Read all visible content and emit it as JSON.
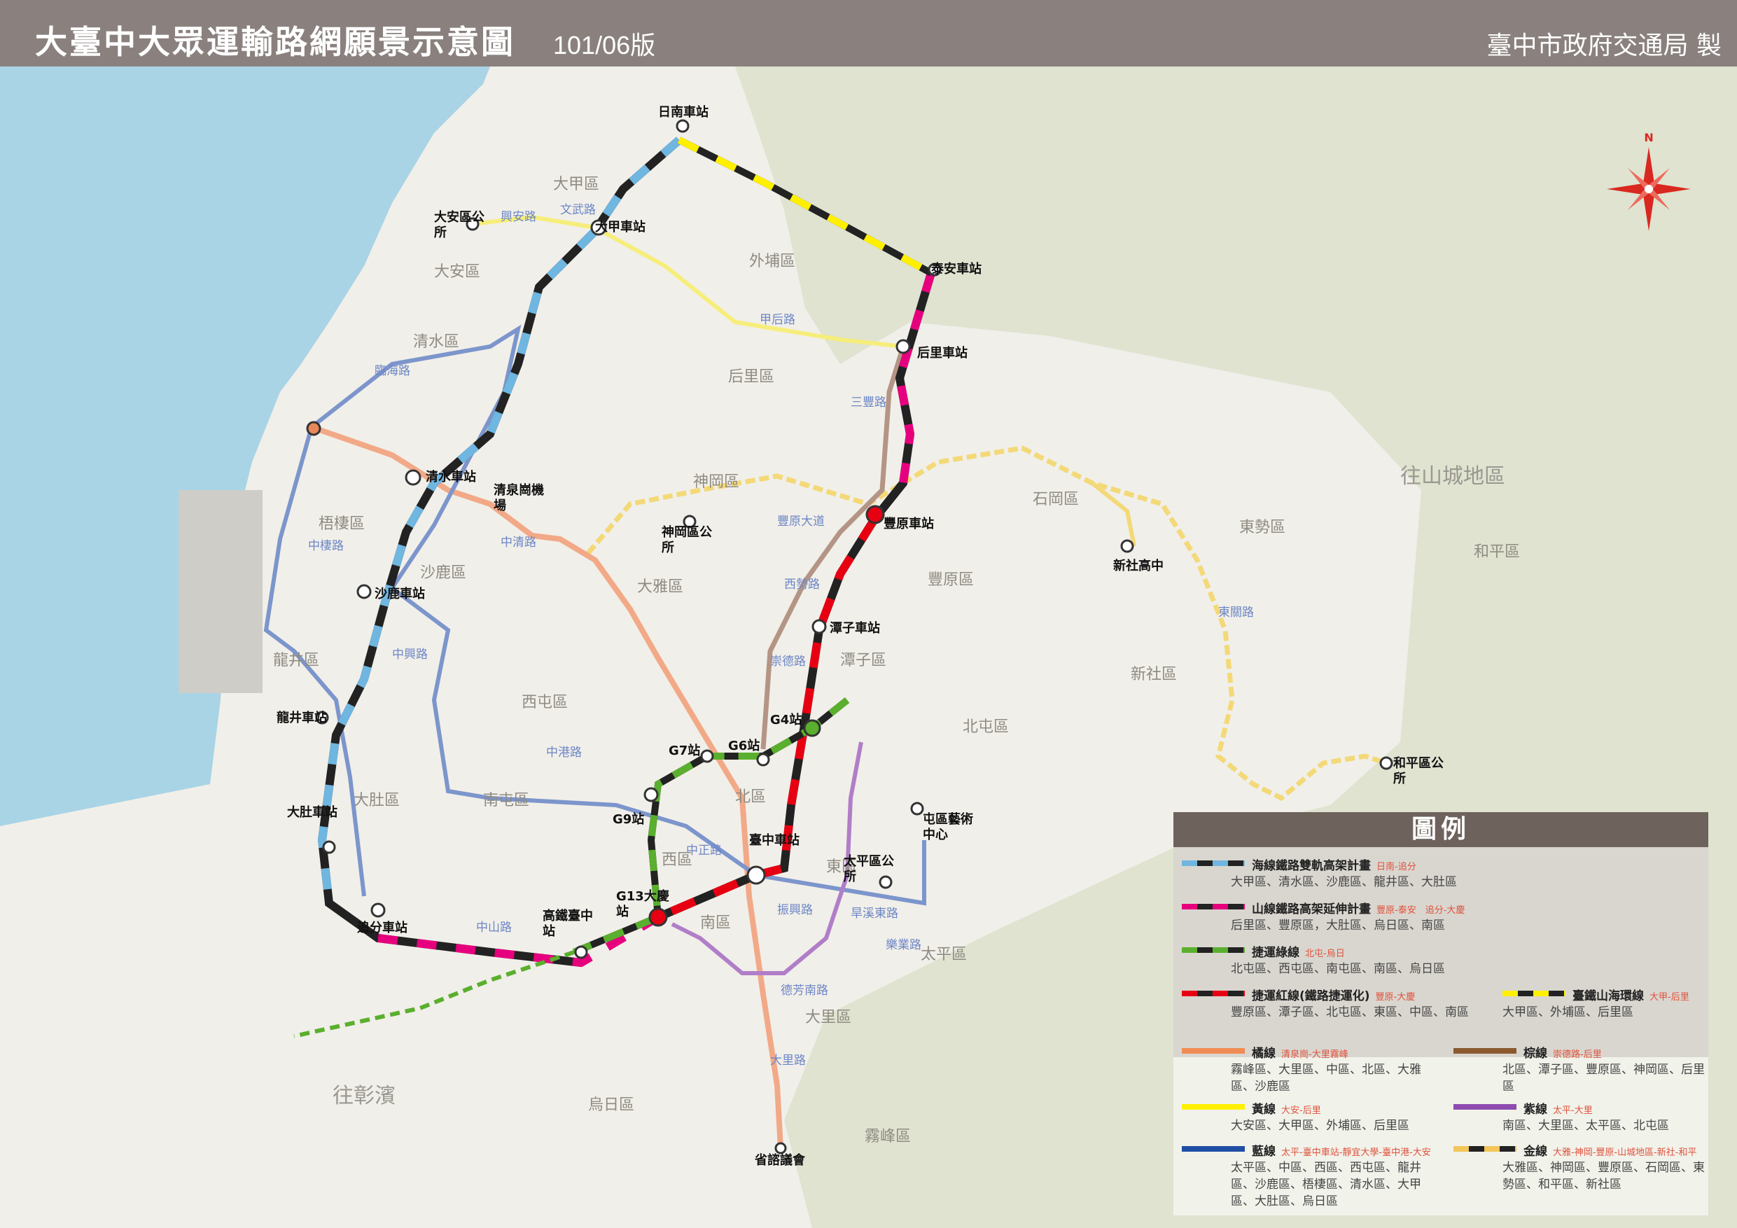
{
  "header": {
    "title": "大臺中大眾運輸路網願景示意圖",
    "version": "101/06版",
    "publisher": "臺中市政府交通局 製"
  },
  "compass": {
    "label": "N"
  },
  "districts": [
    "大甲區",
    "外埔區",
    "大安區",
    "清水區",
    "后里區",
    "神岡區",
    "石岡區",
    "東勢區",
    "和平區",
    "梧棲區",
    "沙鹿區",
    "大雅區",
    "豐原區",
    "新社區",
    "龍井區",
    "西屯區",
    "潭子區",
    "北屯區",
    "大肚區",
    "南屯區",
    "北區",
    "西區",
    "東區",
    "南區",
    "太平區",
    "大里區",
    "烏日區",
    "霧峰區",
    "往山城地區",
    "往彰濱"
  ],
  "stations": [
    "日南車站",
    "大甲車站",
    "大安區公所",
    "泰安車站",
    "后里車站",
    "清水車站",
    "清泉崗機場",
    "豐原車站",
    "神岡區公所",
    "新社高中",
    "沙鹿車站",
    "潭子車站",
    "G4站",
    "G7站",
    "G6站",
    "龍井車站",
    "G9站",
    "和平區公所",
    "屯區藝術中心",
    "大肚車站",
    "臺中車站",
    "太平區公所",
    "G13大慶站",
    "高鐵臺中站",
    "追分車站",
    "省諮議會"
  ],
  "roads": [
    "興安路",
    "文武路",
    "甲后路",
    "臨海路",
    "三豐路",
    "中清路",
    "豐原大道",
    "西勢路",
    "中棲路",
    "中興路",
    "中港路",
    "崇德路",
    "中山路",
    "中正路",
    "東關路",
    "振興路",
    "大里路",
    "德芳南路",
    "樂業路",
    "旱溪東路"
  ],
  "legend": {
    "heading": "圖例",
    "lines": [
      {
        "name": "海線鐵路雙軌高架計畫",
        "route": "日南-追分",
        "districts": "大甲區、清水區、沙鹿區、龍井區、大肚區"
      },
      {
        "name": "山線鐵路高架延伸計畫",
        "route": "豐原-泰安　追分-大慶",
        "districts": "后里區、豐原區，大肚區、烏日區、南區"
      },
      {
        "name": "捷運綠線",
        "route": "北屯-烏日",
        "districts": "北屯區、西屯區、南屯區、南區、烏日區"
      },
      {
        "name": "捷運紅線(鐵路捷運化)",
        "route": "豐原-大慶",
        "districts": "豐原區、潭子區、北屯區、東區、中區、南區"
      },
      {
        "name": "臺鐵山海環線",
        "route": "大甲-后里",
        "districts": "大甲區、外埔區、后里區"
      },
      {
        "name": "橘線",
        "route": "清泉崗-大里霧峰",
        "districts": "霧峰區、大里區、中區、北區、大雅區、沙鹿區"
      },
      {
        "name": "棕線",
        "route": "崇德路-后里",
        "districts": "北區、潭子區、豐原區、神岡區、后里區"
      },
      {
        "name": "黃線",
        "route": "大安-后里",
        "districts": "大安區、大甲區、外埔區、后里區"
      },
      {
        "name": "紫線",
        "route": "太平-大里",
        "districts": "南區、大里區、太平區、北屯區"
      },
      {
        "name": "藍線",
        "route": "太平-臺中車站-靜宜大學-臺中港-大安",
        "districts": "太平區、中區、西區、西屯區、龍井區、沙鹿區、梧棲區、清水區、大甲區、大肚區、烏日區"
      },
      {
        "name": "金線",
        "route": "大雅-神岡-豐原-山城地區-新社-和平",
        "districts": "大雅區、神岡區、豐原區、石岡區、東勢區、和平區、新社區"
      }
    ]
  },
  "colors": {
    "header_bg": "#8a817e",
    "sea": "#a9d4e6",
    "mountain": "#dfe3d0",
    "coast_line_blue": "#6fb6e0",
    "mountain_line_pink": "#e6007e",
    "green_line": "#5aaf2e",
    "red_line": "#e60012",
    "yellow_black": "#fff000",
    "orange": "#f08b55",
    "brown": "#9b7a6a",
    "yellow": "#f6ee7a",
    "purple": "#b07ec8",
    "blue": "#6c86c6",
    "gold": "#f3c65a"
  }
}
